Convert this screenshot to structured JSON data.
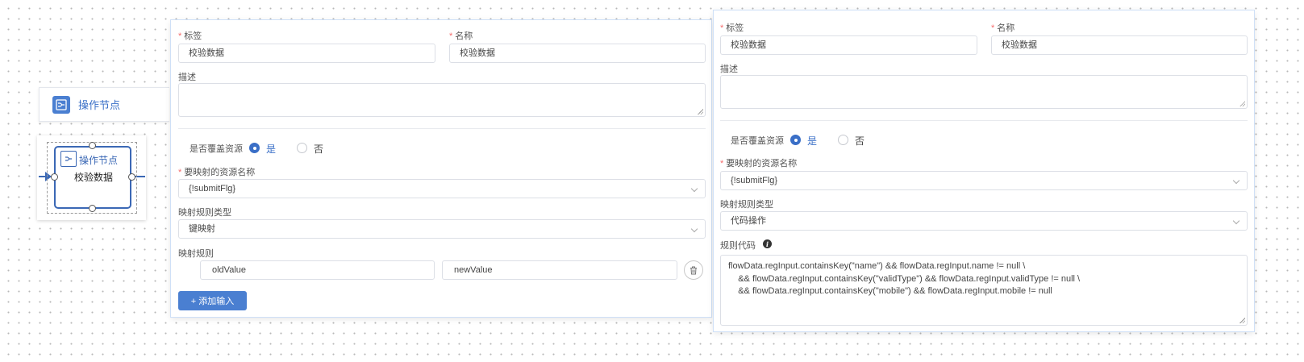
{
  "palette": {
    "node_label": "操作节点"
  },
  "canvas_node": {
    "type_label": "操作节点",
    "name": "校验数据"
  },
  "left_form": {
    "tag_label": "标签",
    "tag_value": "校验数据",
    "name_label": "名称",
    "name_value": "校验数据",
    "desc_label": "描述",
    "desc_value": "",
    "override_label": "是否覆盖资源",
    "yes_label": "是",
    "no_label": "否",
    "override_selected": "是",
    "resource_label": "要映射的资源名称",
    "resource_value": "{!submitFlg}",
    "rule_type_label": "映射规则类型",
    "rule_type_value": "键映射",
    "rule_label": "映射规则",
    "rule_key_value": "oldValue",
    "rule_val_value": "newValue",
    "add_input_label": "+ 添加输入"
  },
  "right_form": {
    "tag_label": "标签",
    "tag_value": "校验数据",
    "name_label": "名称",
    "name_value": "校验数据",
    "desc_label": "描述",
    "desc_value": "",
    "override_label": "是否覆盖资源",
    "yes_label": "是",
    "no_label": "否",
    "override_selected": "是",
    "resource_label": "要映射的资源名称",
    "resource_value": "{!submitFlg}",
    "rule_type_label": "映射规则类型",
    "rule_type_value": "代码操作",
    "code_label": "规则代码",
    "code_value": "flowData.regInput.containsKey(\"name\") && flowData.regInput.name != null \\\n    && flowData.regInput.containsKey(\"validType\") && flowData.regInput.validType != null \\\n    && flowData.regInput.containsKey(\"mobile\") && flowData.regInput.mobile != null"
  },
  "colors": {
    "accent": "#3a6fc7",
    "required": "#f56c6c",
    "node_border": "#3b68b5"
  },
  "icons": [
    "operation-node-icon",
    "chevron-down-icon",
    "delete-icon",
    "info-icon"
  ]
}
